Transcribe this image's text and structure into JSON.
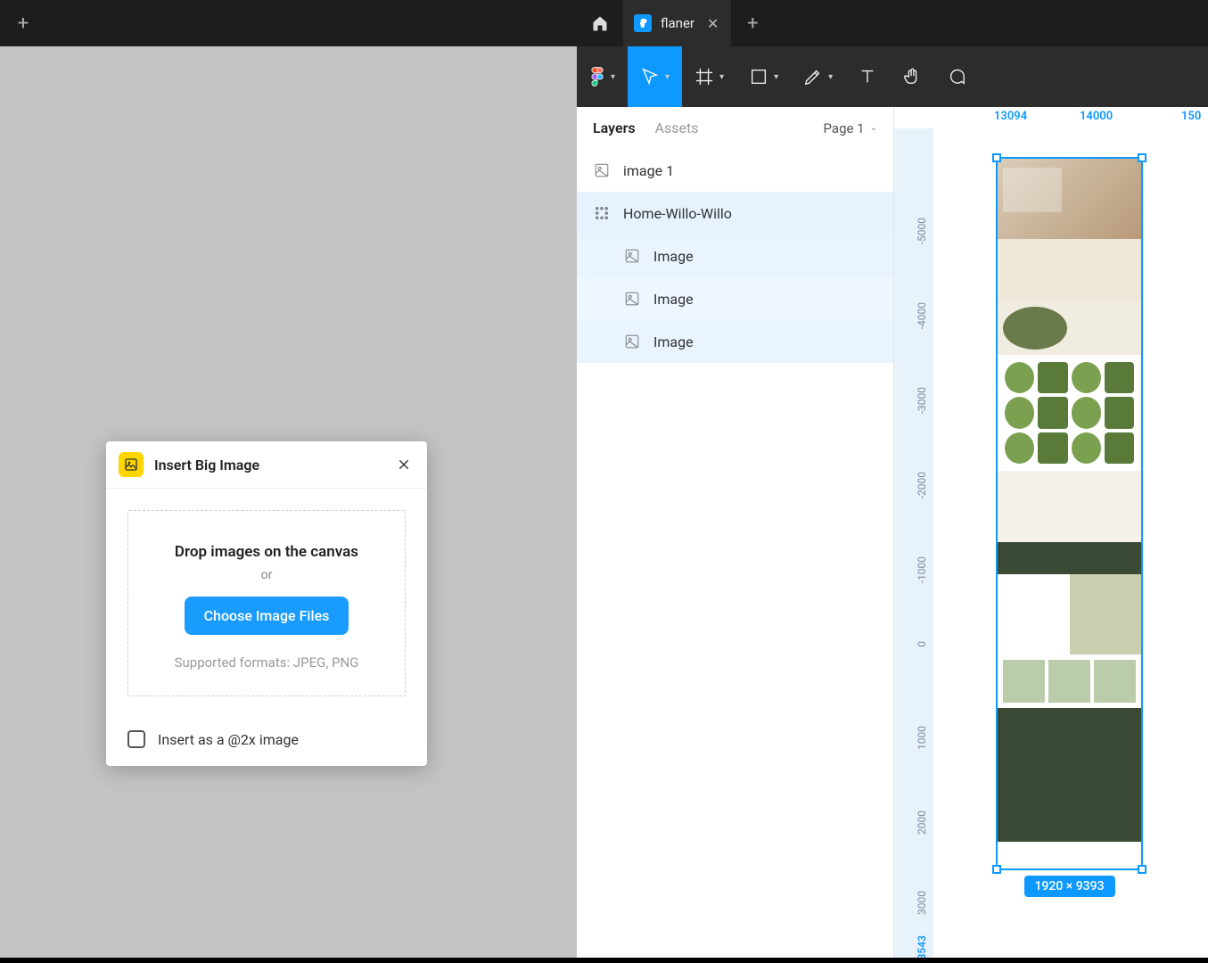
{
  "left": {
    "dialog": {
      "title": "Insert Big Image",
      "drop_text": "Drop images on the canvas",
      "or": "or",
      "choose_btn": "Choose Image Files",
      "supported": "Supported formats: JPEG, PNG",
      "at2x_label": "Insert as a @2x image"
    }
  },
  "right": {
    "tab_name": "flaner",
    "panel": {
      "layers_label": "Layers",
      "assets_label": "Assets",
      "page_label": "Page 1",
      "items": {
        "image1": "image 1",
        "frame": "Home-Willo-Willo",
        "img_a": "Image",
        "img_b": "Image",
        "img_c": "Image"
      }
    },
    "ruler": {
      "h": {
        "a": "13094",
        "b": "14000",
        "c": "150"
      },
      "v": [
        "-5000",
        "-4000",
        "-3000",
        "-2000",
        "-1000",
        "0",
        "1000",
        "2000",
        "3000"
      ],
      "current": "3543"
    },
    "selection_size": "1920 × 9393"
  }
}
